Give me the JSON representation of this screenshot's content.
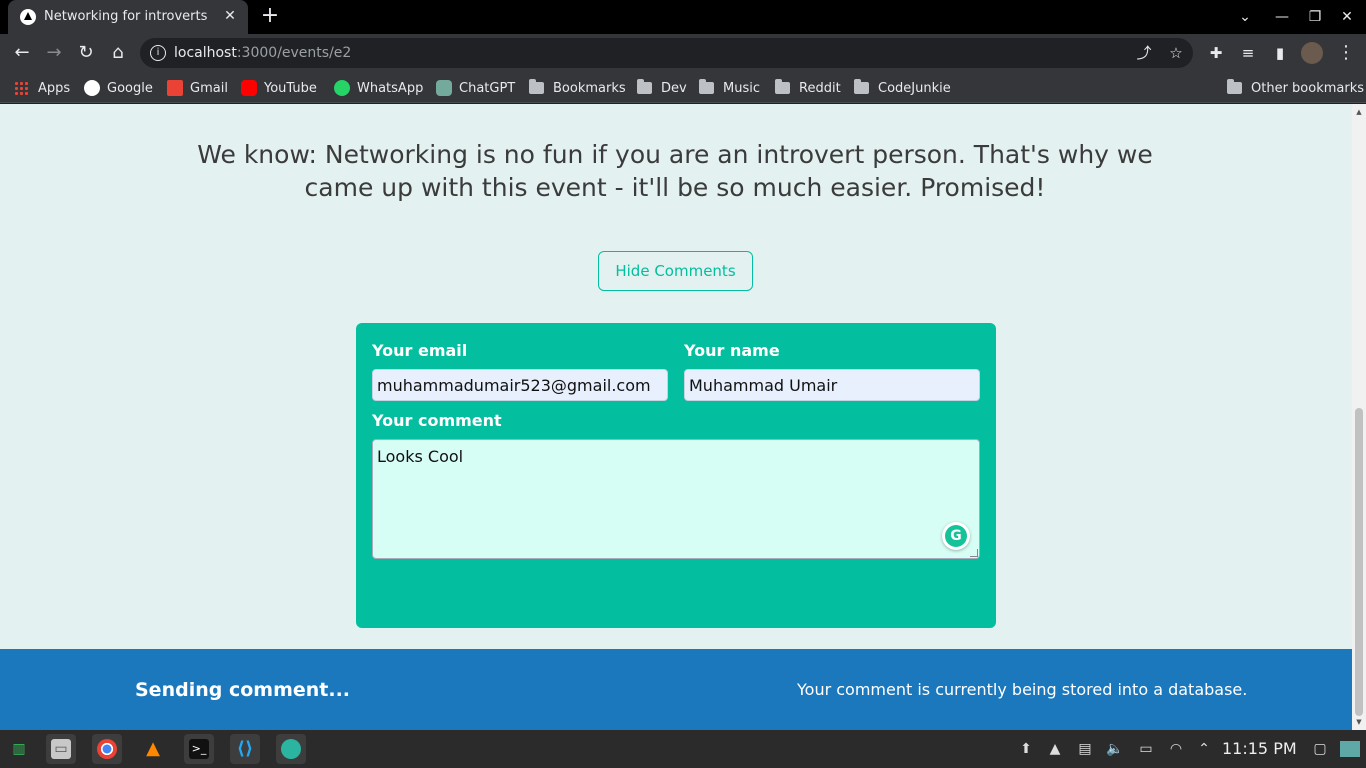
{
  "browser": {
    "tab_title": "Networking for introverts",
    "tab_close": "✕",
    "new_tab": "+",
    "url_host": "localhost",
    "url_path": ":3000/events/e2"
  },
  "bookmarks": {
    "items": [
      {
        "label": "Apps",
        "icon": "apps-grid-icon"
      },
      {
        "label": "Google",
        "icon": "google-icon",
        "color": "#4285f4"
      },
      {
        "label": "Gmail",
        "icon": "gmail-icon",
        "color": "#ea4335"
      },
      {
        "label": "YouTube",
        "icon": "youtube-icon",
        "color": "#ff0000"
      },
      {
        "label": "WhatsApp",
        "icon": "whatsapp-icon",
        "color": "#25d366"
      },
      {
        "label": "ChatGPT",
        "icon": "chatgpt-icon",
        "color": "#74aa9c"
      },
      {
        "label": "Bookmarks",
        "icon": "folder-icon"
      },
      {
        "label": "Dev",
        "icon": "folder-icon"
      },
      {
        "label": "Music",
        "icon": "folder-icon"
      },
      {
        "label": "Reddit",
        "icon": "folder-icon"
      },
      {
        "label": "CodeJunkie",
        "icon": "folder-icon"
      }
    ],
    "other": "Other bookmarks"
  },
  "page": {
    "intro": "We know: Networking is no fun if you are an introvert person. That's why we came up with this event - it'll be so much easier. Promised!",
    "hide_comments": "Hide Comments",
    "form": {
      "email_label": "Your email",
      "email_value": "muhammadumair523@gmail.com",
      "name_label": "Your name",
      "name_value": "Muhammad Umair",
      "comment_label": "Your comment",
      "comment_value": "Looks Cool"
    },
    "notification": {
      "title": "Sending comment...",
      "message": "Your comment is currently being stored into a database."
    }
  },
  "taskbar": {
    "clock": "11:15 PM"
  },
  "colors": {
    "accent": "#03be9f",
    "notification": "#1b78bd",
    "page_bg": "#e3f1f0"
  }
}
